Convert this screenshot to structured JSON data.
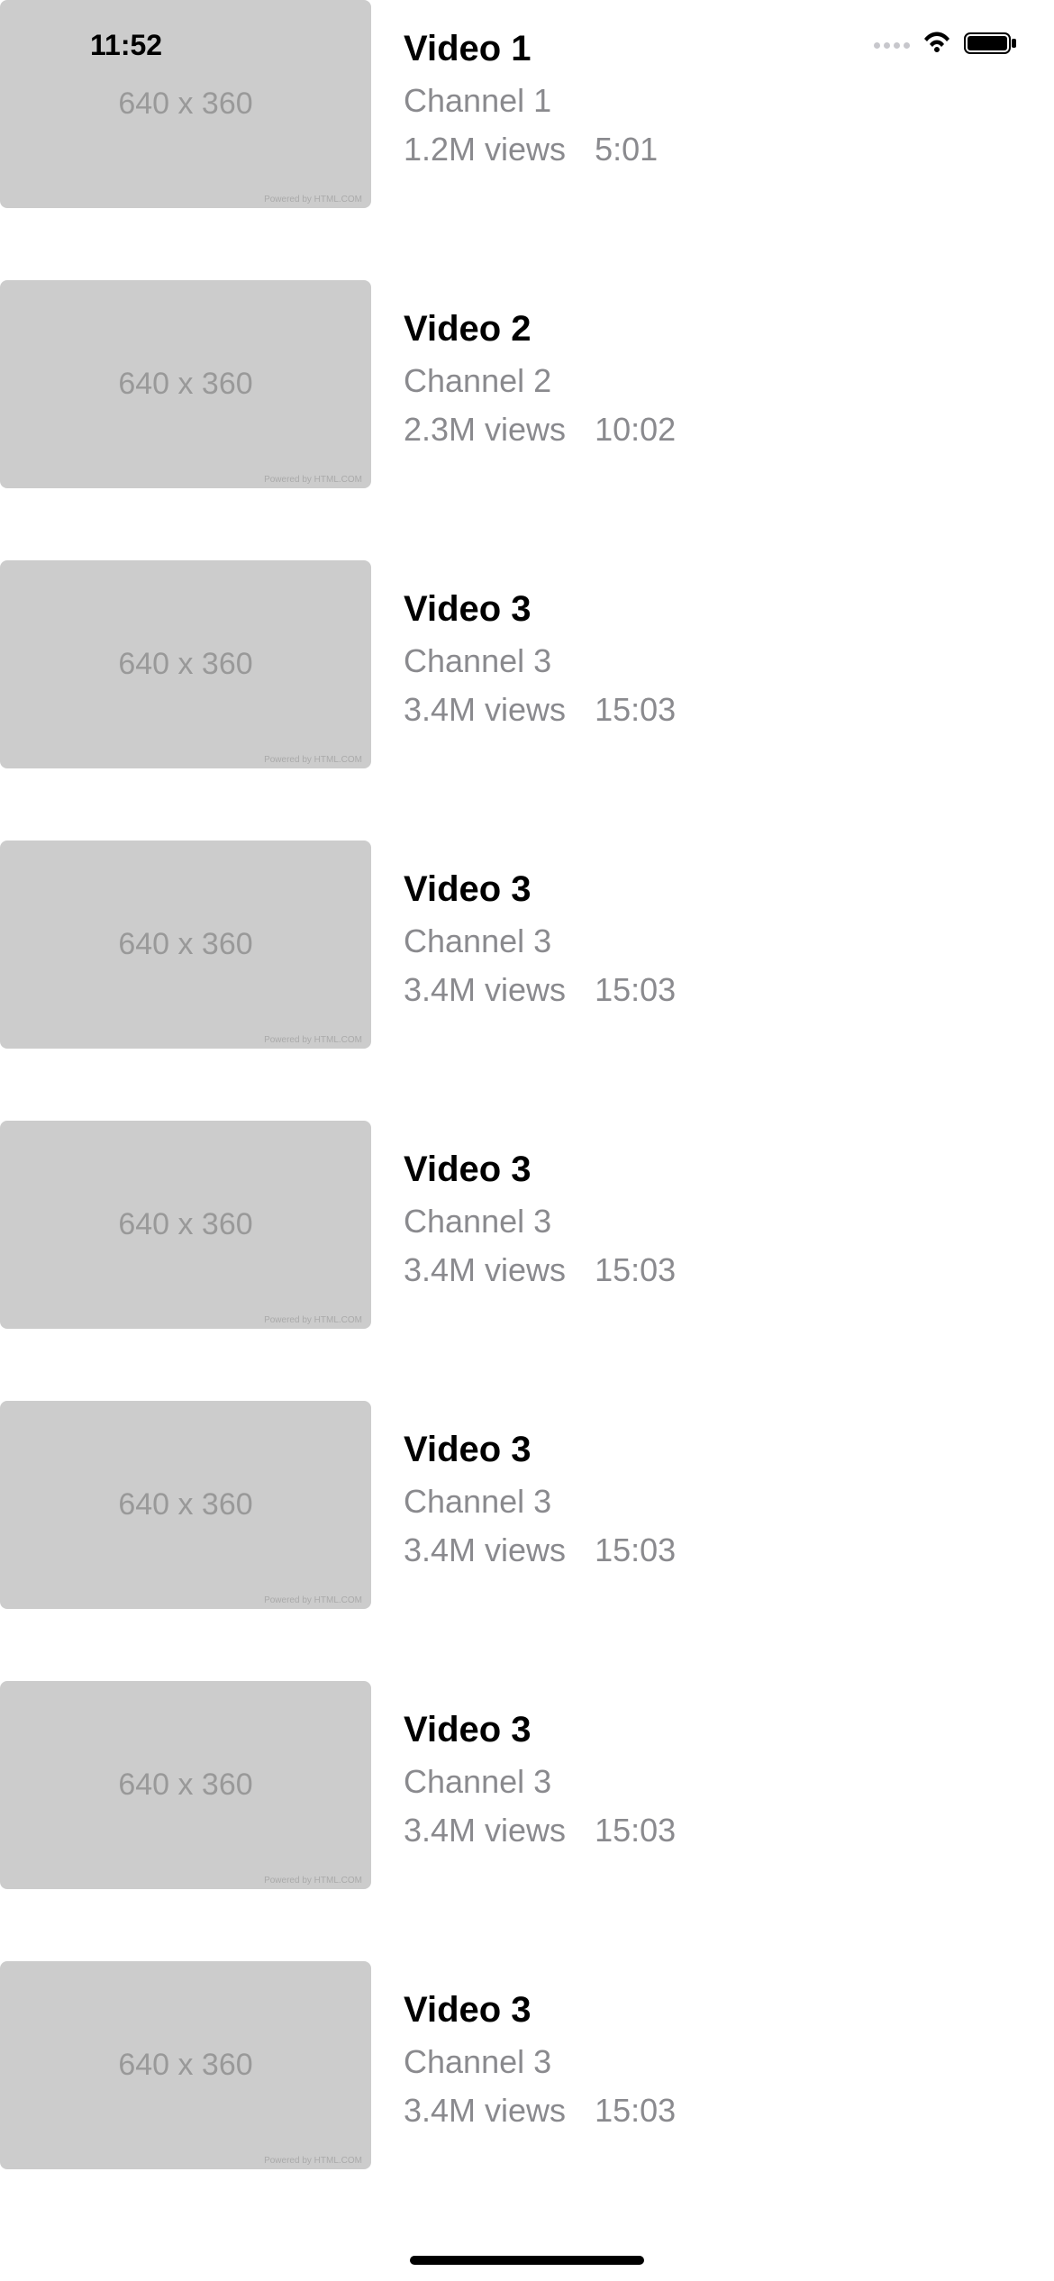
{
  "status_bar": {
    "time": "11:52"
  },
  "thumbnail": {
    "label": "640 x 360",
    "attrib": "Powered by HTML.COM"
  },
  "videos": [
    {
      "title": "Video 1",
      "channel": "Channel 1",
      "views": "1.2M views",
      "duration": "5:01"
    },
    {
      "title": "Video 2",
      "channel": "Channel 2",
      "views": "2.3M views",
      "duration": "10:02"
    },
    {
      "title": "Video 3",
      "channel": "Channel 3",
      "views": "3.4M views",
      "duration": "15:03"
    },
    {
      "title": "Video 3",
      "channel": "Channel 3",
      "views": "3.4M views",
      "duration": "15:03"
    },
    {
      "title": "Video 3",
      "channel": "Channel 3",
      "views": "3.4M views",
      "duration": "15:03"
    },
    {
      "title": "Video 3",
      "channel": "Channel 3",
      "views": "3.4M views",
      "duration": "15:03"
    },
    {
      "title": "Video 3",
      "channel": "Channel 3",
      "views": "3.4M views",
      "duration": "15:03"
    },
    {
      "title": "Video 3",
      "channel": "Channel 3",
      "views": "3.4M views",
      "duration": "15:03"
    }
  ]
}
